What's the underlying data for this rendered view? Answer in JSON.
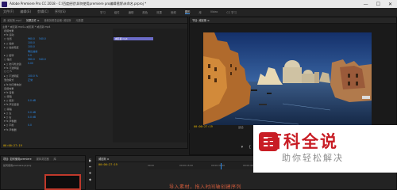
{
  "window": {
    "title": "Adobe Premiere Pro CC 2018 - C:\\百度经验\\如何使用premiere pro编辑视频\\未命名.prproj *",
    "buttons": [
      "—",
      "☐",
      "✕"
    ]
  },
  "menubar": {
    "items": [
      "文件(F)",
      "编辑(E)",
      "剪辑(C)",
      "序列(S)",
      "标记(M)",
      "图形(G)",
      "窗口(W)",
      "帮助(H)"
    ],
    "active_index": -1
  },
  "workspaces": {
    "items": [
      "学习",
      "组件",
      "编辑",
      "颜色",
      "效果",
      "音频",
      "图形",
      "库",
      "Video",
      "CC 学习"
    ],
    "active_index": 3
  },
  "effect_controls": {
    "tabs": [
      "源: 威尼斯.mp4",
      "效果控件 ≡",
      "音频剪辑混合器: 威尼斯",
      "元数据"
    ],
    "active_tab": 1,
    "header": "主要 * 威尼斯.mp4 ▸ 威尼斯 * 威尼斯.mp4",
    "rows": [
      {
        "label": "视频效果",
        "v1": "",
        "v2": ""
      },
      {
        "label": "▾ fx 运动",
        "v1": "",
        "v2": ""
      },
      {
        "label": "○ 位置",
        "v1": "960.0",
        "v2": "540.0"
      },
      {
        "label": "▸ ○ 缩放",
        "v1": "100.0",
        "v2": ""
      },
      {
        "label": "▸ ○ 缩放宽度",
        "v1": "100.0",
        "v2": ""
      },
      {
        "label": "",
        "v1": "等比缩放",
        "v2": ""
      },
      {
        "label": "▸ ○ 旋转",
        "v1": "0.0",
        "v2": ""
      },
      {
        "label": "○ 锚点",
        "v1": "960.0",
        "v2": "540.0"
      },
      {
        "label": "▸ ○ 防闪烁滤镜",
        "v1": "0.00",
        "v2": ""
      },
      {
        "label": "▾ fx 不透明度",
        "v1": "",
        "v2": ""
      },
      {
        "label": "○ □ ✎",
        "v1": "",
        "v2": ""
      },
      {
        "label": "▸ ○ 不透明度",
        "v1": "100.0 %",
        "v2": ""
      },
      {
        "label": "混合模式",
        "v1": "正常",
        "v2": ""
      },
      {
        "label": "▸ fx 时间重映射",
        "v1": "",
        "v2": ""
      },
      {
        "label": "音频效果",
        "v1": "",
        "v2": ""
      },
      {
        "label": "▾ fx 音量",
        "v1": "",
        "v2": ""
      },
      {
        "label": "○ 旁路",
        "v1": "",
        "v2": ""
      },
      {
        "label": "▸ ○ 级别",
        "v1": "0.0 dB",
        "v2": ""
      },
      {
        "label": "▾ fx 声道音量",
        "v1": "",
        "v2": ""
      },
      {
        "label": "○ 旁路",
        "v1": "",
        "v2": ""
      },
      {
        "label": "▸ ○ 左",
        "v1": "0.0 dB",
        "v2": ""
      },
      {
        "label": "▸ ○ 右",
        "v1": "0.0 dB",
        "v2": ""
      },
      {
        "label": "▾ fx 声像器",
        "v1": "",
        "v2": ""
      },
      {
        "label": "▸ ○ 平衡",
        "v1": "0.0",
        "v2": ""
      },
      {
        "label": "▾ fx 声像器",
        "v1": "",
        "v2": ""
      }
    ],
    "timecode": "00:00:27:19",
    "clip_label": "威尼斯.mp4"
  },
  "program_monitor": {
    "tab": "节目: 威尼斯 ≡",
    "timecode_left": "00:00:27:19",
    "fit": "适合",
    "quality": "完整",
    "timecode_right": "00:00:47:21",
    "controls": [
      "▾",
      "{",
      "}",
      "|◀",
      "◀|",
      "▶",
      "|▶",
      "▶|",
      "⇲",
      "⇱",
      "📷",
      "+"
    ]
  },
  "project_panel": {
    "tabs": [
      "项目: 如何使用premiere",
      "媒体浏览器",
      "库"
    ],
    "item_label": "如何使用premiere.prproj"
  },
  "timeline": {
    "tab": "威尼斯 ≡",
    "timecode": "00:00:27:19",
    "ruler_marks": [
      "00:00",
      "00:00:15:00",
      "00:00:30:00",
      "00:00:45:00",
      "00:01:00:00",
      "00:01:15:00",
      "00:01:30:00",
      "00:01:45:00"
    ],
    "caption": "导入素材，拖入时间轴创建序列"
  },
  "tools": {
    "items": [
      "▶",
      "⇹",
      "✥",
      "◆"
    ]
  },
  "watermark": {
    "title": "百科全说",
    "subtitle": "助你轻松解决"
  }
}
